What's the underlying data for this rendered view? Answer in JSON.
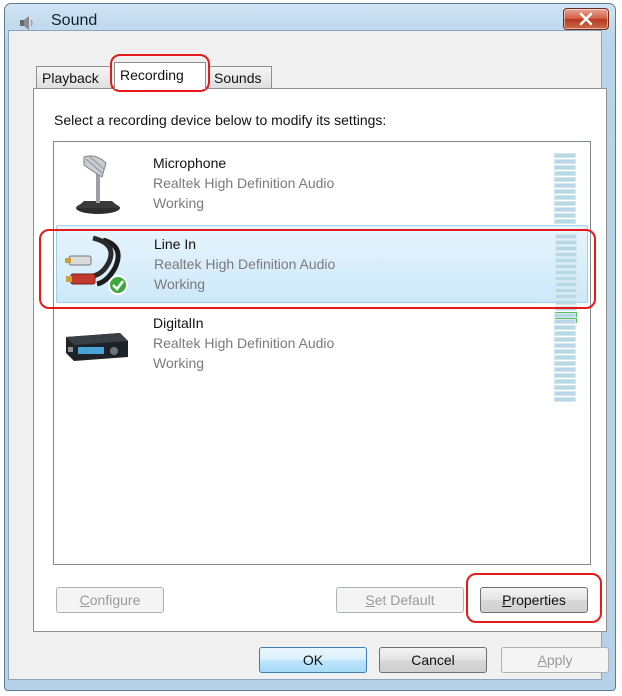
{
  "window": {
    "title": "Sound",
    "icon": "speaker-icon",
    "close_icon": "close-icon"
  },
  "tabs": [
    {
      "label": "Playback",
      "active": false
    },
    {
      "label": "Recording",
      "active": true
    },
    {
      "label": "Sounds",
      "active": false
    }
  ],
  "instruction": "Select a recording device below to modify its settings:",
  "devices": [
    {
      "name": "Microphone",
      "description": "Realtek High Definition Audio",
      "status": "Working",
      "icon": "microphone-icon",
      "selected": false,
      "default": false,
      "level_fraction": 0
    },
    {
      "name": "Line In",
      "description": "Realtek High Definition Audio",
      "status": "Working",
      "icon": "rca-cable-icon",
      "selected": true,
      "default": true,
      "level_fraction": 0.14
    },
    {
      "name": "DigitalIn",
      "description": "Realtek High Definition Audio",
      "status": "Working",
      "icon": "digital-receiver-icon",
      "selected": false,
      "default": false,
      "level_fraction": 0
    }
  ],
  "buttons": {
    "configure": {
      "label": "Configure",
      "mnemonic": "C",
      "enabled": false
    },
    "set_default": {
      "label": "Set Default",
      "mnemonic": "S",
      "enabled": false
    },
    "properties": {
      "label": "Properties",
      "mnemonic": "P",
      "enabled": true
    },
    "ok": {
      "label": "OK",
      "enabled": true
    },
    "cancel": {
      "label": "Cancel",
      "enabled": true
    },
    "apply": {
      "label": "Apply",
      "mnemonic": "A",
      "enabled": false
    }
  },
  "colors": {
    "highlight": "#e51b1b",
    "selection": "#cde9f9",
    "meter_active": "#2e8b2e",
    "meter_idle": "#b9d8e6"
  }
}
